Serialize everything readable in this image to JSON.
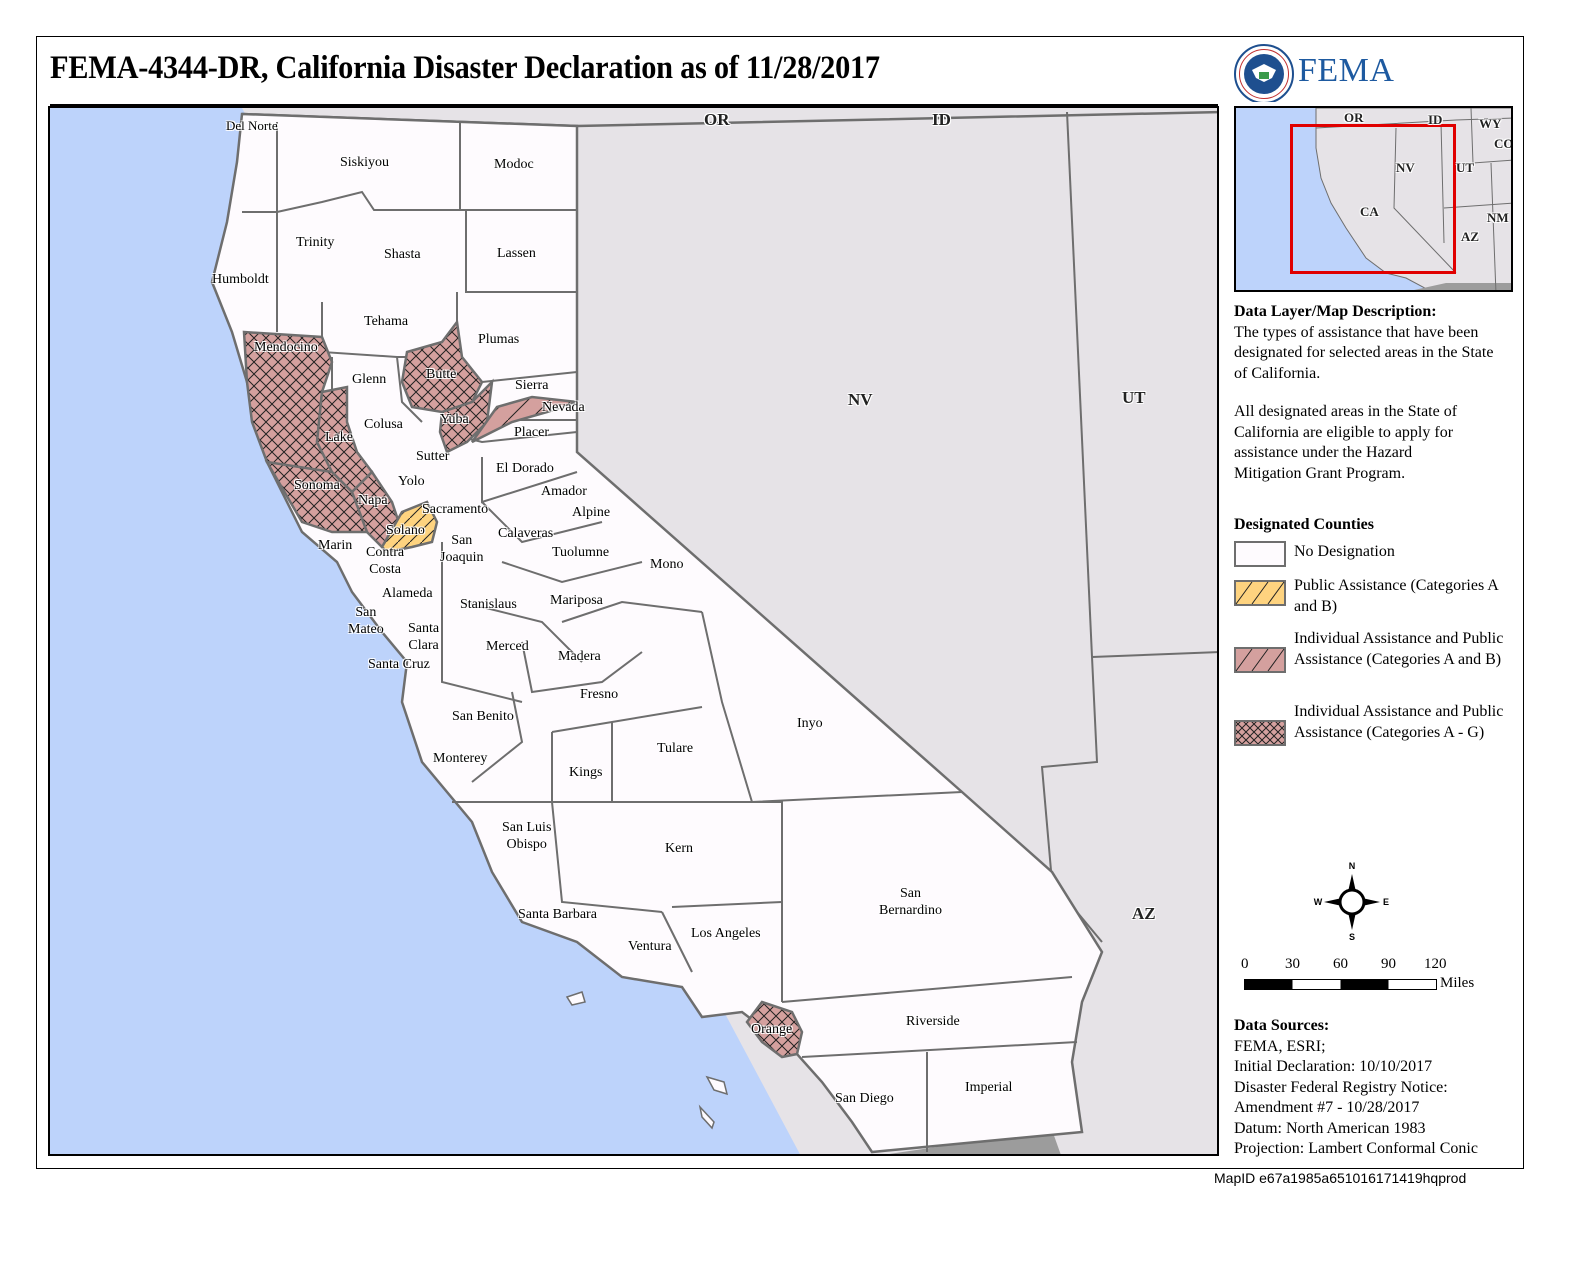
{
  "title": "FEMA-4344-DR, California Disaster Declaration as of 11/28/2017",
  "logo": {
    "agency": "FEMA",
    "seal_icon": "dhs-seal-icon"
  },
  "colors": {
    "ocean": "#bdd3fb",
    "other_states": "#e6e3e7",
    "no_designation": "#fefbfe",
    "public_assistance_ab": "#fed37f",
    "ia_pa_ab": "#d4a09e",
    "ia_pa_ag": "#d4a09e",
    "county_border": "#6e6e6e",
    "inset_box": "#e00000",
    "mexico": "#9c9c9c"
  },
  "map": {
    "state_labels": [
      {
        "id": "or",
        "text": "OR"
      },
      {
        "id": "id",
        "text": "ID"
      },
      {
        "id": "nv",
        "text": "NV"
      },
      {
        "id": "ut",
        "text": "UT"
      },
      {
        "id": "az",
        "text": "AZ"
      }
    ],
    "counties": [
      {
        "name": "Del Norte",
        "designation": "none"
      },
      {
        "name": "Siskiyou",
        "designation": "none"
      },
      {
        "name": "Modoc",
        "designation": "none"
      },
      {
        "name": "Trinity",
        "designation": "none"
      },
      {
        "name": "Shasta",
        "designation": "none"
      },
      {
        "name": "Lassen",
        "designation": "none"
      },
      {
        "name": "Humboldt",
        "designation": "none"
      },
      {
        "name": "Tehama",
        "designation": "none"
      },
      {
        "name": "Plumas",
        "designation": "none"
      },
      {
        "name": "Mendocino",
        "designation": "ia_pa_ag"
      },
      {
        "name": "Butte",
        "designation": "ia_pa_ag"
      },
      {
        "name": "Glenn",
        "designation": "none"
      },
      {
        "name": "Sierra",
        "designation": "none"
      },
      {
        "name": "Nevada",
        "designation": "ia_pa_ab"
      },
      {
        "name": "Yuba",
        "designation": "ia_pa_ag"
      },
      {
        "name": "Colusa",
        "designation": "none"
      },
      {
        "name": "Lake",
        "designation": "ia_pa_ag"
      },
      {
        "name": "Placer",
        "designation": "none"
      },
      {
        "name": "Sutter",
        "designation": "none"
      },
      {
        "name": "El Dorado",
        "designation": "none"
      },
      {
        "name": "Yolo",
        "designation": "none"
      },
      {
        "name": "Sonoma",
        "designation": "ia_pa_ag"
      },
      {
        "name": "Amador",
        "designation": "none"
      },
      {
        "name": "Napa",
        "designation": "ia_pa_ag"
      },
      {
        "name": "Sacramento",
        "designation": "none"
      },
      {
        "name": "Alpine",
        "designation": "none"
      },
      {
        "name": "Solano",
        "designation": "pa_ab"
      },
      {
        "name": "Calaveras",
        "designation": "none"
      },
      {
        "name": "Marin",
        "designation": "none"
      },
      {
        "name": "San Joaquin",
        "designation": "none"
      },
      {
        "name": "Contra Costa",
        "designation": "none"
      },
      {
        "name": "Tuolumne",
        "designation": "none"
      },
      {
        "name": "Mono",
        "designation": "none"
      },
      {
        "name": "Alameda",
        "designation": "none"
      },
      {
        "name": "Stanislaus",
        "designation": "none"
      },
      {
        "name": "Mariposa",
        "designation": "none"
      },
      {
        "name": "San Mateo",
        "designation": "none"
      },
      {
        "name": "Santa Clara",
        "designation": "none"
      },
      {
        "name": "Merced",
        "designation": "none"
      },
      {
        "name": "Madera",
        "designation": "none"
      },
      {
        "name": "Santa Cruz",
        "designation": "none"
      },
      {
        "name": "Fresno",
        "designation": "none"
      },
      {
        "name": "San Benito",
        "designation": "none"
      },
      {
        "name": "Inyo",
        "designation": "none"
      },
      {
        "name": "Tulare",
        "designation": "none"
      },
      {
        "name": "Monterey",
        "designation": "none"
      },
      {
        "name": "Kings",
        "designation": "none"
      },
      {
        "name": "San Luis Obispo",
        "designation": "none"
      },
      {
        "name": "Kern",
        "designation": "none"
      },
      {
        "name": "San Bernardino",
        "designation": "none"
      },
      {
        "name": "Santa Barbara",
        "designation": "none"
      },
      {
        "name": "Ventura",
        "designation": "none"
      },
      {
        "name": "Los Angeles",
        "designation": "none"
      },
      {
        "name": "Orange",
        "designation": "ia_pa_ag"
      },
      {
        "name": "Riverside",
        "designation": "none"
      },
      {
        "name": "San Diego",
        "designation": "none"
      },
      {
        "name": "Imperial",
        "designation": "none"
      }
    ],
    "labels": {
      "del_norte": "Del Norte",
      "siskiyou": "Siskiyou",
      "modoc": "Modoc",
      "trinity": "Trinity",
      "shasta": "Shasta",
      "lassen": "Lassen",
      "humboldt": "Humboldt",
      "tehama": "Tehama",
      "plumas": "Plumas",
      "mendocino": "Mendocino",
      "butte": "Butte",
      "glenn": "Glenn",
      "sierra": "Sierra",
      "nevada": "Nevada",
      "yuba": "Yuba",
      "colusa": "Colusa",
      "lake": "Lake",
      "placer": "Placer",
      "sutter": "Sutter",
      "el_dorado": "El Dorado",
      "yolo": "Yolo",
      "sonoma": "Sonoma",
      "amador": "Amador",
      "napa": "Napa",
      "sacramento": "Sacramento",
      "alpine": "Alpine",
      "solano": "Solano",
      "calaveras": "Calaveras",
      "marin": "Marin",
      "san_joaquin": "San\nJoaquin",
      "contra_costa": "Contra\nCosta",
      "tuolumne": "Tuolumne",
      "mono": "Mono",
      "alameda": "Alameda",
      "stanislaus": "Stanislaus",
      "mariposa": "Mariposa",
      "san_mateo": "San\nMateo",
      "santa_clara": "Santa\nClara",
      "merced": "Merced",
      "madera": "Madera",
      "santa_cruz": "Santa Cruz",
      "fresno": "Fresno",
      "san_benito": "San Benito",
      "inyo": "Inyo",
      "tulare": "Tulare",
      "monterey": "Monterey",
      "kings": "Kings",
      "san_luis_obispo": "San Luis\nObispo",
      "kern": "Kern",
      "san_bernardino": "San\nBernardino",
      "santa_barbara": "Santa Barbara",
      "ventura": "Ventura",
      "los_angeles": "Los Angeles",
      "orange": "Orange",
      "riverside": "Riverside",
      "san_diego": "San Diego",
      "imperial": "Imperial"
    }
  },
  "inset": {
    "labels": {
      "or": "OR",
      "id": "ID",
      "wy": "WY",
      "co": "CO",
      "nv": "NV",
      "ut": "UT",
      "ca": "CA",
      "nm": "NM",
      "az": "AZ"
    }
  },
  "description": {
    "heading": "Data Layer/Map Description:",
    "para1": "The types of assistance that have been designated for selected areas in the State of California.",
    "para2": "All designated areas in the State of California are eligible to apply for assistance under the Hazard Mitigation Grant Program."
  },
  "legend": {
    "heading": "Designated Counties",
    "items": [
      {
        "key": "none",
        "label": "No Designation"
      },
      {
        "key": "pa_ab",
        "label": "Public Assistance (Categories A and B)"
      },
      {
        "key": "ia_pa_ab",
        "label": "Individual Assistance and Public Assistance (Categories A and B)"
      },
      {
        "key": "ia_pa_ag",
        "label": "Individual Assistance and Public Assistance (Categories A - G)"
      }
    ]
  },
  "compass": {
    "n": "N",
    "s": "S",
    "e": "E",
    "w": "W"
  },
  "scale_bar": {
    "ticks": [
      "0",
      "30",
      "60",
      "90",
      "120"
    ],
    "unit": "Miles"
  },
  "sources": {
    "heading": "Data Sources:",
    "lines": [
      "FEMA, ESRI;",
      "Initial Declaration: 10/10/2017",
      "Disaster Federal Registry Notice:",
      "Amendment #7 - 10/28/2017",
      "Datum: North American 1983",
      "Projection: Lambert Conformal Conic"
    ]
  },
  "map_id": "MapID e67a1985a651016171419hqprod"
}
